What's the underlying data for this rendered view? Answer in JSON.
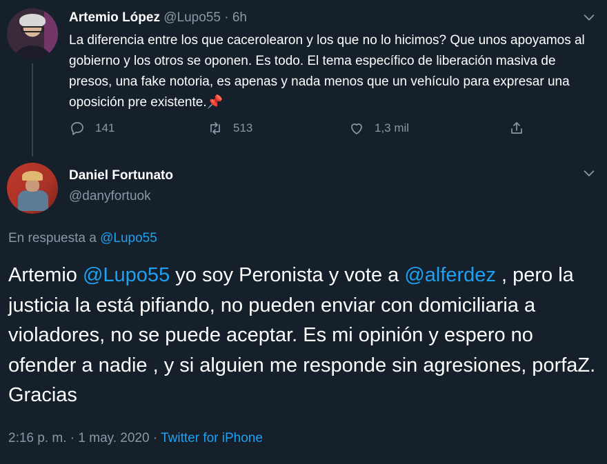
{
  "parent_tweet": {
    "author_name": "Artemio López",
    "author_handle": "@Lupo55",
    "separator": "·",
    "time": "6h",
    "text": "La diferencia entre los que cacerolearon y los que no lo hicimos? Que unos apoyamos al gobierno y los otros se oponen. Es todo. El tema específico de liberación masiva de presos, una fake notoria, es apenas y nada menos que un vehículo para expresar una oposición pre existente.",
    "text_emoji": "📌",
    "replies": "141",
    "retweets": "513",
    "likes": "1,3 mil"
  },
  "main_tweet": {
    "author_name": "Daniel Fortunato",
    "author_handle": "@danyfortuok",
    "reply_prefix": "En respuesta a ",
    "reply_to": "@Lupo55",
    "text_part1": "Artemio ",
    "mention1": "@Lupo55",
    "text_part2": " yo soy Peronista y vote a ",
    "mention2": "@alferdez",
    "text_part3": " , pero la justicia la está pifiando, no pueden enviar con domiciliaria a violadores, no se puede aceptar. Es mi opinión y espero no ofender a nadie , y si alguien me responde sin agresiones, porfaZ. Gracias",
    "time": "2:16 p. m.",
    "sep1": " · ",
    "date": "1 may. 2020",
    "sep2": " · ",
    "source": "Twitter for iPhone"
  },
  "colors": {
    "background": "#15202b",
    "text": "#ffffff",
    "muted": "#8899a6",
    "link": "#1da1f2",
    "thread_line": "#38444d"
  },
  "icons": [
    "reply-icon",
    "retweet-icon",
    "like-icon",
    "share-icon",
    "chevron-down-icon"
  ]
}
